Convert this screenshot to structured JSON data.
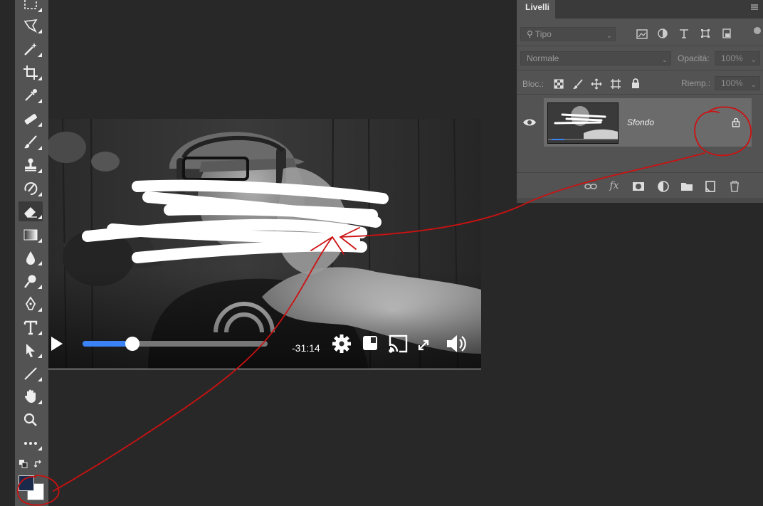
{
  "colors": {
    "workspace": "#282828",
    "toolbar": "#535353",
    "panel": "#535353",
    "annotation_red": "#cc1111",
    "progress_blue": "#3b82f6",
    "foreground_swatch": "#1b2a4a",
    "background_swatch": "#ffffff"
  },
  "toolbar": {
    "tools": [
      {
        "name": "marquee-icon"
      },
      {
        "name": "lasso-icon"
      },
      {
        "name": "magic-wand-icon"
      },
      {
        "name": "crop-icon"
      },
      {
        "name": "eyedropper-icon"
      },
      {
        "name": "healing-brush-icon"
      },
      {
        "name": "brush-icon"
      },
      {
        "name": "clone-stamp-icon"
      },
      {
        "name": "history-brush-icon"
      },
      {
        "name": "eraser-icon",
        "active": true
      },
      {
        "name": "gradient-icon"
      },
      {
        "name": "blur-icon"
      },
      {
        "name": "dodge-icon"
      },
      {
        "name": "pen-icon"
      },
      {
        "name": "type-icon"
      },
      {
        "name": "path-selection-icon"
      },
      {
        "name": "line-icon"
      },
      {
        "name": "hand-icon"
      },
      {
        "name": "zoom-icon"
      },
      {
        "name": "more-tools-icon"
      }
    ]
  },
  "video": {
    "time_remaining": "-31:14",
    "progress_fraction": 0.27
  },
  "layers_panel": {
    "tab_label": "Livelli",
    "filter_placeholder": "Tipo",
    "blend_mode": "Normale",
    "opacity_label": "Opacità:",
    "opacity_value": "100%",
    "lock_label": "Bloc.:",
    "fill_label": "Riemp.:",
    "fill_value": "100%",
    "layers": [
      {
        "name": "Sfondo",
        "visible": true,
        "locked": true
      }
    ]
  }
}
